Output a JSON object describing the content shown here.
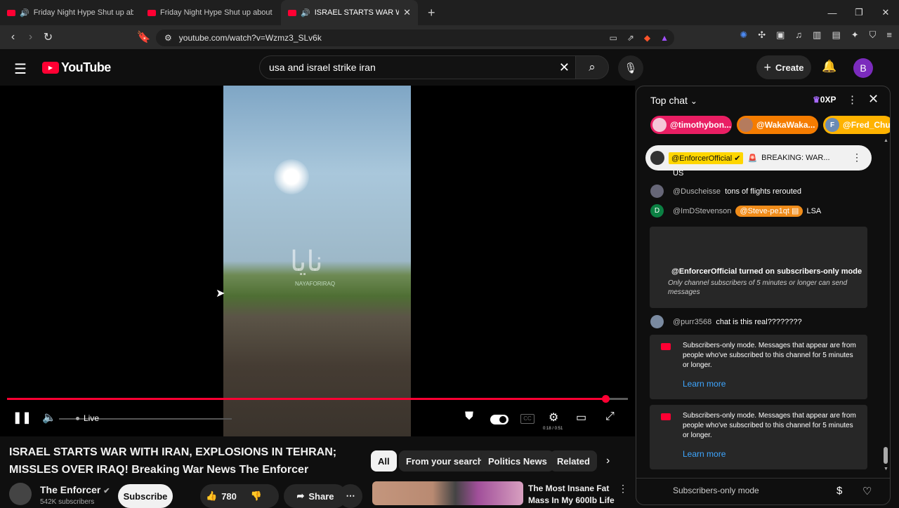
{
  "browser": {
    "tabs": [
      {
        "title": "Friday Night Hype Shut up about",
        "active": false
      },
      {
        "title": "Friday Night Hype Shut up about toe",
        "active": false
      },
      {
        "title": "ISRAEL STARTS WAR WITH IR",
        "active": true
      }
    ],
    "url": "youtube.com/watch?v=Wzmz3_SLv6k"
  },
  "header": {
    "logo": "YouTube",
    "search_value": "usa and israel strike iran",
    "create_label": "Create",
    "avatar_letter": "B"
  },
  "player": {
    "live_label": "Live",
    "watermark": "نايا",
    "watermark_sub": "NAYAFORIRAQ",
    "time_text": "0:18 / 0:51",
    "progress_fraction": 0.964
  },
  "video": {
    "title": "ISRAEL STARTS WAR WITH IRAN, EXPLOSIONS IN TEHRAN; MISSLES OVER IRAQ! Breaking War News The Enforcer",
    "channel": "The Enforcer",
    "subscribers": "542K subscribers",
    "subscribe_label": "Subscribe",
    "likes": "780",
    "share_label": "Share"
  },
  "chips": [
    "All",
    "From your search",
    "Politics News",
    "Related"
  ],
  "recommended": {
    "title": "The Most Insane Fat Mass In My 600lb Life"
  },
  "chat": {
    "header": "Top chat",
    "xp": "0XP",
    "tickers": [
      "@timothybon...",
      "@WakaWaka...",
      "@Fred_Church"
    ],
    "ticker_initial": "F",
    "pinned_author": "@EnforcerOfficial",
    "pinned_text": "BREAKING: WAR...",
    "partial_text": "US",
    "messages": [
      {
        "author": "@Duscheisse",
        "text": "tons of flights rerouted",
        "initial": ""
      },
      {
        "author": "@ImDStevenson",
        "mention": "@Steve-pe1qt",
        "text": "LSA",
        "initial": "D"
      }
    ],
    "system_title": "@EnforcerOfficial turned on subscribers-only mode",
    "system_text": "Only channel subscribers of 5 minutes or longer can send messages",
    "msg3_author": "@purr3568",
    "msg3_text": "chat is this real????????",
    "notice_text": "Subscribers-only mode. Messages that appear are from people who've subscribed to this channel for 5 minutes or longer.",
    "learn_more": "Learn more",
    "footer_mode": "Subscribers-only mode"
  }
}
